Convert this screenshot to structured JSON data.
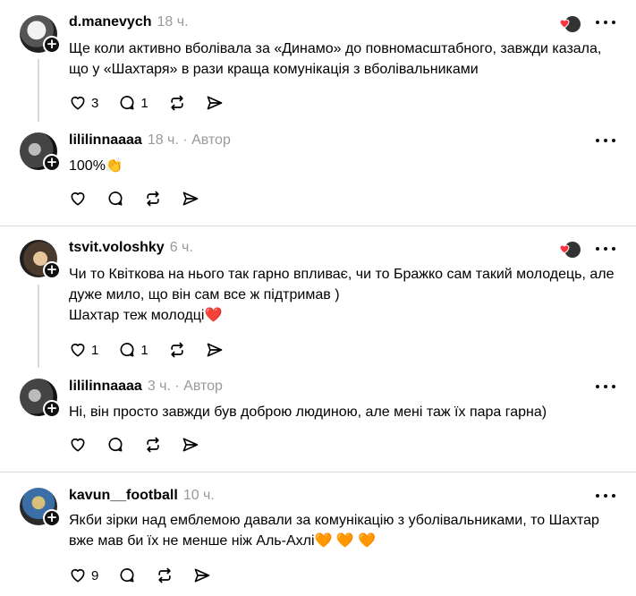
{
  "threads": [
    {
      "user": "d.manevych",
      "time": "18 ч.",
      "text": "Ще коли активно вболівала за «Динамо» до повномасштабного, завжди казала, що у «Шахтаря» в рази краща комунікація з вболівальниками",
      "likes": "3",
      "replies": "1",
      "reply": {
        "user": "lililinnaaaa",
        "time": "18 ч.",
        "author_label": "· Автор",
        "text": "100%👏"
      }
    },
    {
      "user": "tsvit.voloshky",
      "time": "6 ч.",
      "text_line1": "Чи то Квіткова на нього так гарно впливає, чи то Бражко сам такий молодець, але дуже мило, що він сам все ж підтримав )",
      "text_line2": "Шахтар теж молодці❤️",
      "likes": "1",
      "replies": "1",
      "reply": {
        "user": "lililinnaaaa",
        "time": "3 ч.",
        "author_label": "· Автор",
        "text": "Ні, він просто завжди був доброю людиною, але мені таж їх пара гарна)"
      }
    },
    {
      "user": "kavun__football",
      "time": "10 ч.",
      "text": "Якби зірки над емблемою давали за комунікацію з уболівальниками, то Шахтар вже мав би їх не менше ніж Аль-Ахлі🧡 🧡 🧡",
      "likes": "9"
    }
  ],
  "colors": {
    "muted": "#9a9a9a",
    "divider": "#dcdcdc",
    "heart": "#ff3040"
  },
  "icons": [
    "heart-icon",
    "comment-icon",
    "repost-icon",
    "share-icon",
    "more-icon",
    "follow-plus-icon"
  ]
}
